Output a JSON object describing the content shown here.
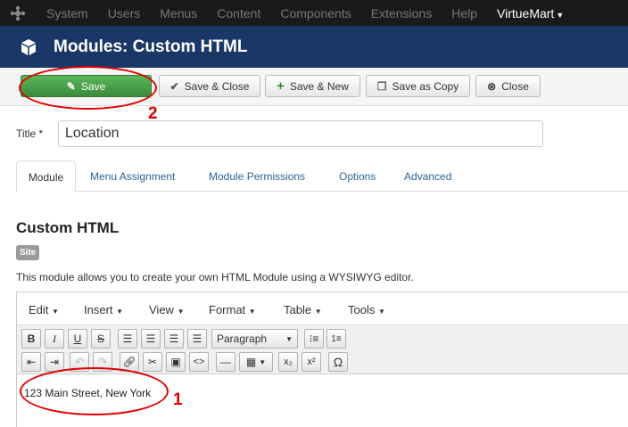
{
  "topnav": {
    "items": [
      "System",
      "Users",
      "Menus",
      "Content",
      "Components",
      "Extensions",
      "Help"
    ],
    "user_menu": "VirtueMart"
  },
  "header": {
    "title": "Modules: Custom HTML"
  },
  "toolbar": {
    "save": "Save",
    "save_close": "Save & Close",
    "save_new": "Save & New",
    "save_copy": "Save as Copy",
    "close": "Close"
  },
  "annotations": {
    "step1": "1",
    "step2": "2"
  },
  "form": {
    "title_label": "Title *",
    "title_value": "Location"
  },
  "tabs": [
    "Module",
    "Menu Assignment",
    "Module Permissions",
    "Options",
    "Advanced"
  ],
  "module": {
    "heading": "Custom HTML",
    "badge": "Site",
    "description": "This module allows you to create your own HTML Module using a WYSIWYG editor."
  },
  "editor": {
    "menus": [
      "Edit",
      "Insert",
      "View",
      "Format",
      "Table",
      "Tools"
    ],
    "format_select": "Paragraph",
    "content": "123 Main Street, New York"
  },
  "colors": {
    "topnav_bg": "#1a1a1a",
    "header_bg": "#1a3867",
    "save_green": "#4a9f4a",
    "annotation_red": "#e00000",
    "link_blue": "#2a6496"
  }
}
